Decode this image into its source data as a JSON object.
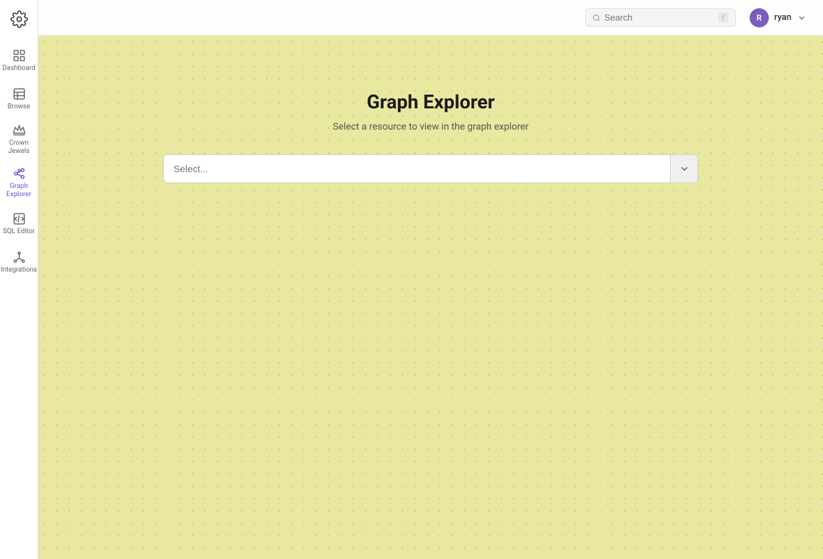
{
  "sidebar": {
    "logo_label": "Settings",
    "items": [
      {
        "id": "dashboard",
        "label": "Dashboard",
        "icon": "grid"
      },
      {
        "id": "browse",
        "label": "Browse",
        "icon": "table"
      },
      {
        "id": "crown-jewels",
        "label": "Crown\nJewels",
        "icon": "crown"
      },
      {
        "id": "graph-explorer",
        "label": "Graph\nExplorer",
        "icon": "graph",
        "active": true
      },
      {
        "id": "sql-editor",
        "label": "SQL Editor",
        "icon": "terminal"
      },
      {
        "id": "integrations",
        "label": "Integrations",
        "icon": "plug"
      }
    ]
  },
  "topbar": {
    "search_placeholder": "Search",
    "search_shortcut": "/",
    "user_name": "ryan",
    "user_initial": "R"
  },
  "main": {
    "title": "Graph Explorer",
    "subtitle": "Select a resource to view in the graph explorer",
    "select_placeholder": "Select..."
  }
}
